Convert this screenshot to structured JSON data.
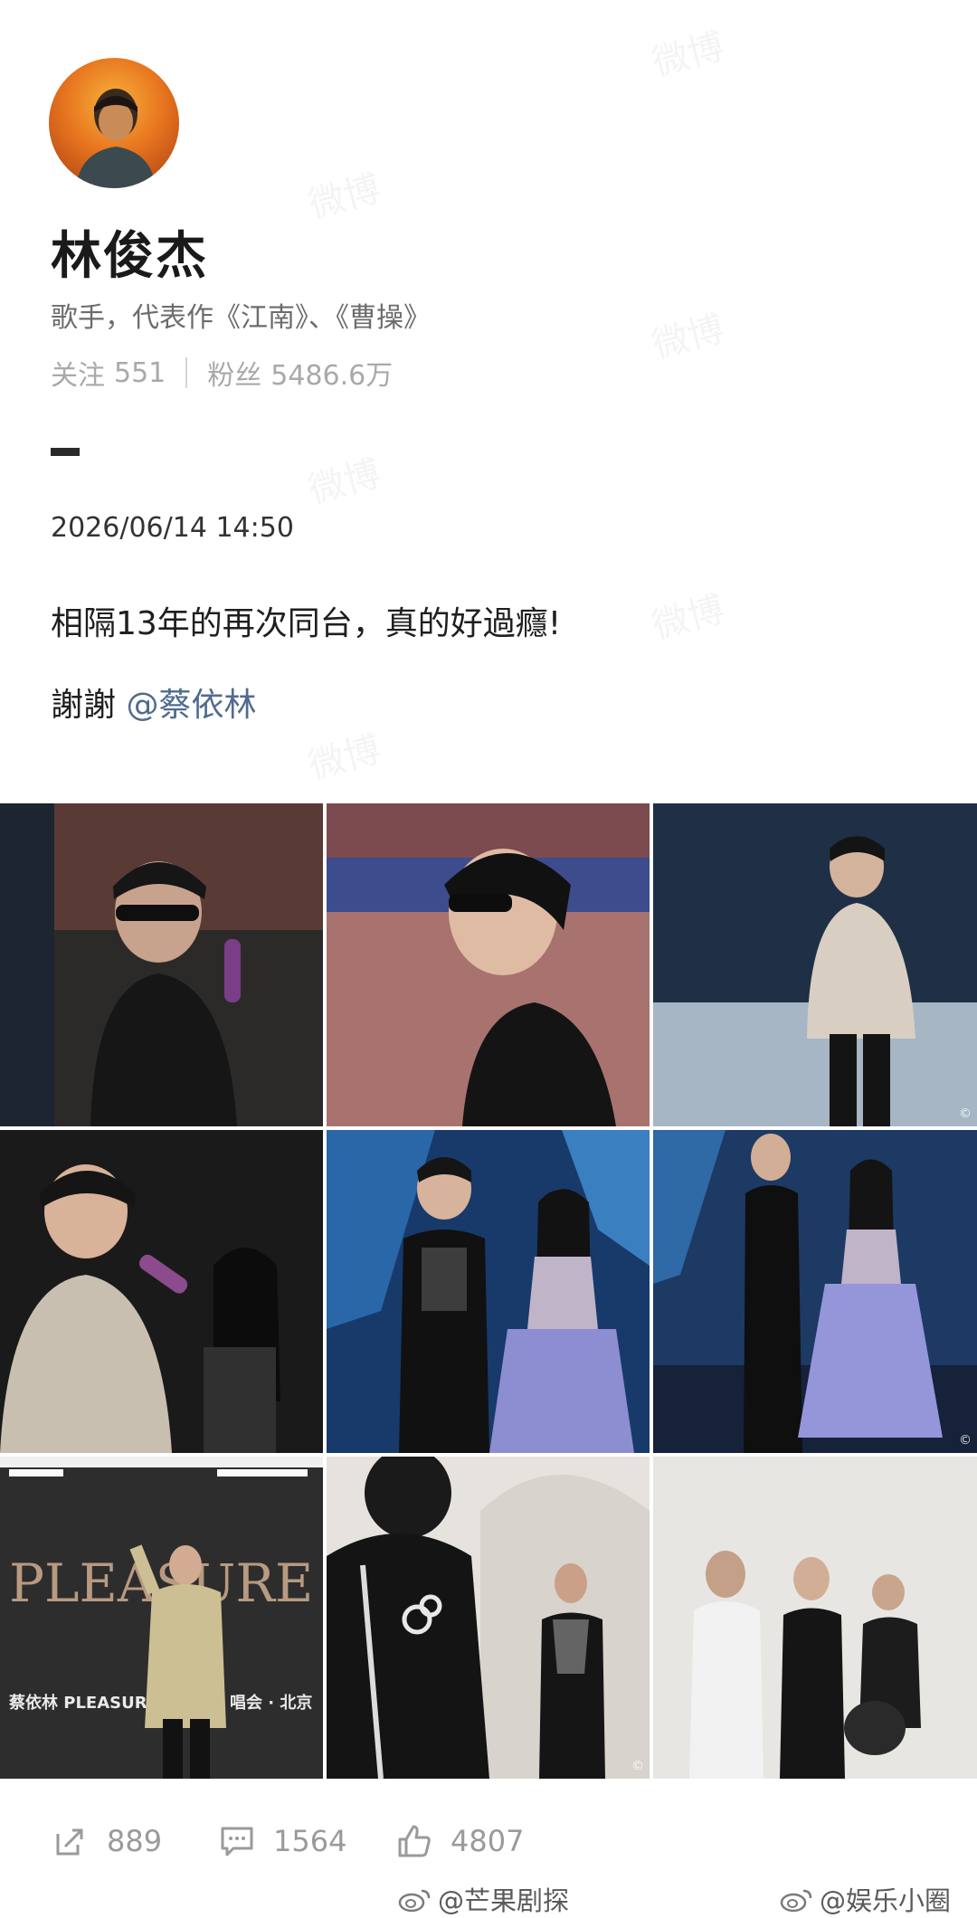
{
  "profile": {
    "name": "林俊杰",
    "bio": "歌手，代表作《江南》、《曹操》",
    "following_label": "关注",
    "following_count": "551",
    "followers_label": "粉丝",
    "followers_count": "5486.6万"
  },
  "post": {
    "timestamp": "2026/06/14 14:50",
    "text": "相隔13年的再次同台，真的好過癮!",
    "thanks_prefix": "謝謝 ",
    "mention": "@蔡依林"
  },
  "photos": [
    {
      "icon": "photo-rehearsal-microphone"
    },
    {
      "icon": "photo-profile-sunglasses"
    },
    {
      "icon": "photo-stage-rehearsal"
    },
    {
      "icon": "photo-duet-rehearsal"
    },
    {
      "icon": "photo-duet-stage"
    },
    {
      "icon": "photo-duet-stage-wide"
    },
    {
      "icon": "photo-pleasure-backdrop",
      "backdrop_title": "PLEASURE",
      "backdrop_caption": "蔡依林 PLEASUR",
      "backdrop_caption_right": "唱会 · 北京"
    },
    {
      "icon": "photo-backstage-jacket"
    },
    {
      "icon": "photo-backstage-group"
    }
  ],
  "actions": {
    "repost_count": "889",
    "comment_count": "1564",
    "like_count": "4807"
  },
  "watermarks": {
    "weibo": "微博",
    "source_left": "@芒果剧探",
    "source_right": "@娱乐小圈"
  },
  "colors": {
    "mention": "#506b8e",
    "muted": "#a9a9a9",
    "text": "#1f1f1f"
  }
}
